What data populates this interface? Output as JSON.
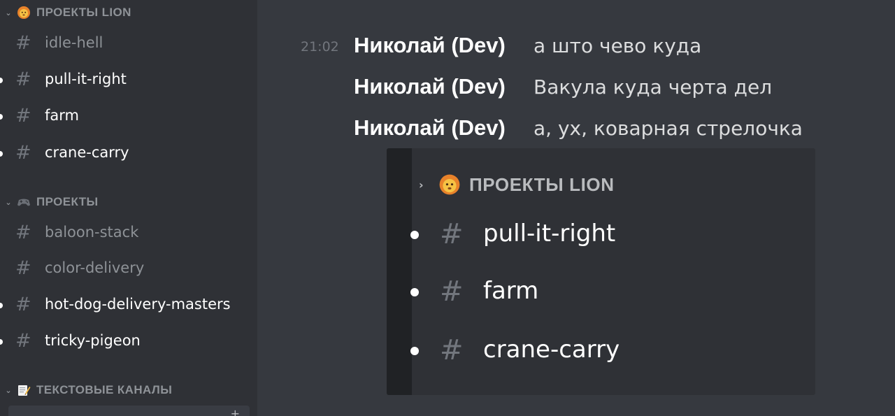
{
  "sidebar": {
    "categories": [
      {
        "label": "ПРОЕКТЫ LION",
        "emoji": "lion-icon"
      },
      {
        "label": "ПРОЕКТЫ",
        "emoji": "gamepad-icon"
      },
      {
        "label": "ТЕКСТОВЫЕ КАНАЛЫ",
        "emoji": "memo-icon"
      }
    ],
    "channels": [
      {
        "label": "idle-hell",
        "unread": false
      },
      {
        "label": "pull-it-right",
        "unread": true
      },
      {
        "label": "farm",
        "unread": true
      },
      {
        "label": "crane-carry",
        "unread": true
      },
      {
        "label": "baloon-stack",
        "unread": false
      },
      {
        "label": "color-delivery",
        "unread": false
      },
      {
        "label": "hot-dog-delivery-masters",
        "unread": true
      },
      {
        "label": "tricky-pigeon",
        "unread": true
      }
    ]
  },
  "chat": {
    "messages": [
      {
        "timestamp": "21:02",
        "author": "Николай (Dev)",
        "text": "а што чево куда"
      },
      {
        "timestamp": "",
        "author": "Николай (Dev)",
        "text": "Вакула куда черта дел"
      },
      {
        "timestamp": "",
        "author": "Николай (Dev)",
        "text": "а, ух, коварная стрелочка"
      }
    ],
    "attachment": {
      "category": {
        "label": "ПРОЕКТЫ LION",
        "emoji": "lion-icon",
        "chevron": "chevron-right-icon"
      },
      "channels": [
        {
          "label": "pull-it-right"
        },
        {
          "label": "farm"
        },
        {
          "label": "crane-carry"
        }
      ]
    }
  },
  "glyphs": {
    "hash": "#",
    "chevron_down": "⌄",
    "chevron_right": "›",
    "plus": "+"
  },
  "colors": {
    "sidebar_bg": "#2f3136",
    "chat_bg": "#36393f",
    "muted_text": "#8e9297",
    "unread_text": "#ffffff",
    "hash_color": "#72767d"
  }
}
